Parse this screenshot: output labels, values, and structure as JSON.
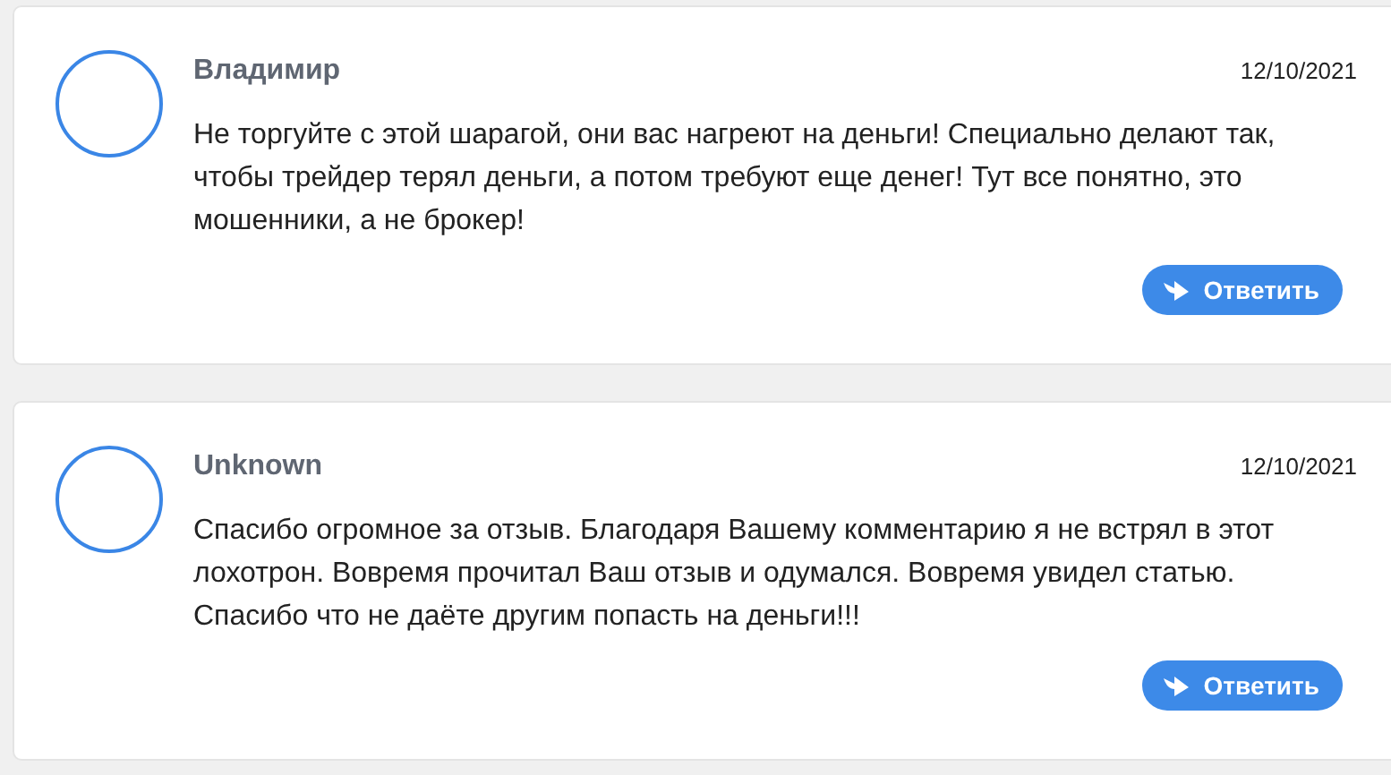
{
  "comments": [
    {
      "author": "Владимир",
      "date": "12/10/2021",
      "text": "Не торгуйте с этой шарагой, они вас нагреют на деньги! Специально делают так, чтобы трейдер терял деньги, а потом требуют еще денег! Тут все понятно, это мошенники, а не брокер!",
      "reply": "Ответить"
    },
    {
      "author": "Unknown",
      "date": "12/10/2021",
      "text": "Спасибо огромное за отзыв. Благодаря Вашему комментарию я не встрял в этот лохотрон. Вовремя прочитал Ваш отзыв и одумался. Вовремя увидел статью. Спасибо что не даёте другим попасть на деньги!!!",
      "reply": "Ответить"
    }
  ]
}
